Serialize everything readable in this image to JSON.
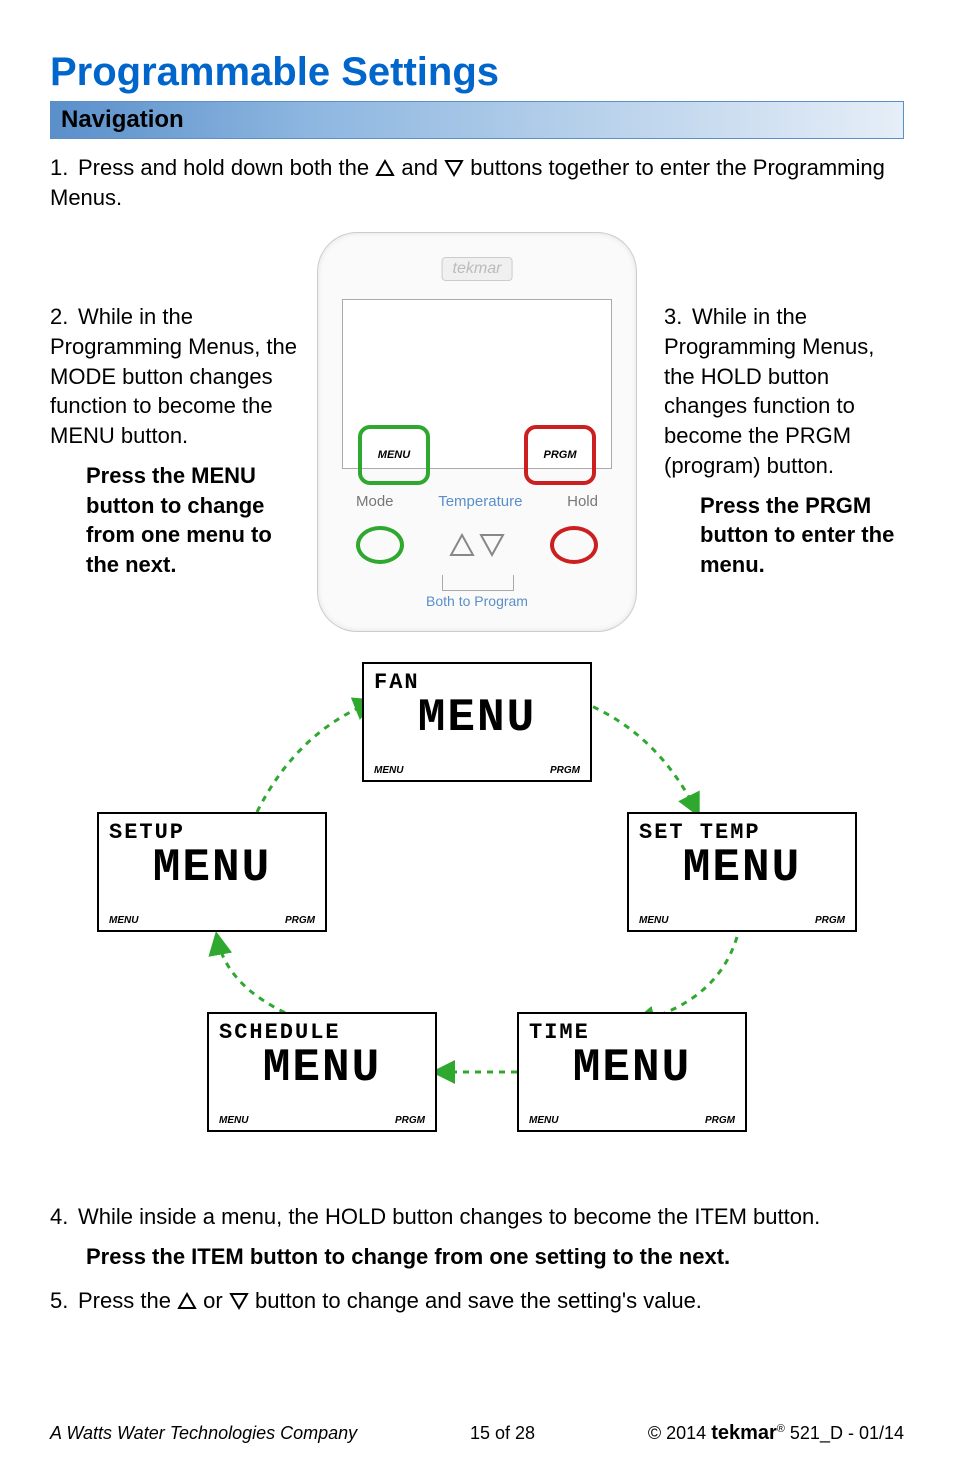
{
  "title": "Programmable Settings",
  "section": "Navigation",
  "step1_a": "1.",
  "step1_b": "Press and hold down both the ",
  "step1_c": " and ",
  "step1_d": " buttons together to enter the Programming Menus.",
  "step2_num": "2.",
  "step2_body": "While in the Programming Menus, the MODE button changes function to become the MENU button.",
  "step2_bold": "Press the MENU button to change from one menu to the next.",
  "step3_num": "3.",
  "step3_body": "While in the Programming Menus, the HOLD button changes function to become the PRGM (program) button.",
  "step3_bold": "Press the PRGM button to enter the menu.",
  "device": {
    "logo": "tekmar",
    "menu_label": "MENU",
    "prgm_label": "PRGM",
    "btn_mode": "Mode",
    "btn_temp": "Temperature",
    "btn_hold": "Hold",
    "both": "Both to Program"
  },
  "menus": {
    "fan": "FAN",
    "settemp": "SET TEMP",
    "time": "TIME",
    "schedule": "SCHEDULE",
    "setup": "SETUP",
    "word": "MENU",
    "left": "MENU",
    "right": "PRGM"
  },
  "step4_num": "4.",
  "step4_body": "While inside a menu, the HOLD button changes to become the ITEM button.",
  "step4_bold": "Press the ITEM button to change from one setting to the next.",
  "step5_num": "5.",
  "step5_a": "Press the ",
  "step5_b": " or ",
  "step5_c": " button to change and save the setting's value.",
  "footer": {
    "left": "A Watts Water Technologies Company",
    "center": "15 of 28",
    "copy": "© 2014 ",
    "brand": "tekmar",
    "tail": " 521_D - 01/14"
  }
}
